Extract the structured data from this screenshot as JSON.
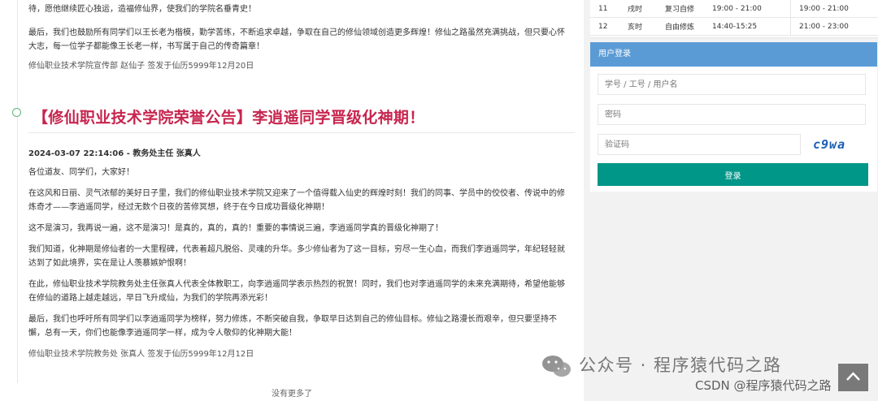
{
  "previous_post": {
    "paragraph_tail": "待，愿他继续匠心独运，造福修仙界，使我们的学院名垂青史！",
    "closing": "最后，我们也鼓励所有同学们以王长老为楷模，勤学苦练，不断追求卓越，争取在自己的修仙领域创造更多辉煌！修仙之路虽然充满挑战，但只要心怀大志，每一位学子都能像王长老一样，书写属于自己的传奇篇章！",
    "signature": "修仙职业技术学院宣传部 赵仙子 签发于仙历5999年12月20日"
  },
  "post": {
    "title": "【修仙职业技术学院荣誉公告】李逍遥同学晋级化神期！",
    "timestamp": "2024-03-07 22:14:06",
    "separator": "-",
    "author": "教务处主任 张真人",
    "paragraphs": [
      "各位道友、同学们，大家好！",
      "在这风和日丽、灵气浓郁的美好日子里，我们的修仙职业技术学院又迎来了一个值得载入仙史的辉煌时刻！我们的同事、学员中的佼佼者、传说中的修炼奇才——李逍遥同学，经过无数个日夜的苦修冥想，终于在今日成功晋级化神期！",
      "这不是演习，我再说一遍，这不是演习！是真的，真的，真的！重要的事情说三遍，李逍遥同学真的晋级化神期了！",
      "我们知道，化神期是修仙者的一大里程碑，代表着超凡脱俗、灵魂的升华。多少修仙者为了这一目标，穷尽一生心血，而我们李逍遥同学，年纪轻轻就达到了如此境界，实在是让人羡慕嫉妒恨啊！",
      "在此，修仙职业技术学院教务处主任张真人代表全体教职工，向李逍遥同学表示热烈的祝贺！同时，我们也对李逍遥同学的未来充满期待，希望他能够在修仙的道路上越走越远，早日飞升成仙，为我们的学院再添光彩！",
      "最后，我们也呼吁所有同学们以李逍遥同学为榜样，努力修炼，不断突破自我，争取早日达到自己的修仙目标。修仙之路漫长而艰辛，但只要坚持不懈，总有一天，你们也能像李逍遥同学一样，成为令人敬仰的化神期大能！"
    ],
    "signature": "修仙职业技术学院教务处 张真人 签发于仙历5999年12月12日"
  },
  "no_more_text": "没有更多了",
  "schedule": {
    "rows": [
      [
        "11",
        "戌时",
        "复习自修",
        "19:00 - 21:00",
        "19:00 - 21:00"
      ],
      [
        "12",
        "亥时",
        "自由修炼",
        "14:40-15:25",
        "21:00 - 23:00"
      ]
    ]
  },
  "login": {
    "header": "用户登录",
    "username_placeholder": "学号 / 工号 / 用户名",
    "password_placeholder": "密码",
    "captcha_placeholder": "验证码",
    "captcha_text": "c9wa",
    "submit_label": "登录"
  },
  "watermark": {
    "text": "公众号 · 程序猿代码之路",
    "csdn": "CSDN @程序猿代码之路"
  },
  "colors": {
    "title": "#c7254e",
    "login_header": "#5b9bd5",
    "login_button": "#009688",
    "timeline_dot": "#5fb878"
  },
  "icons": {
    "timeline_dot": "circle-outline",
    "back_to_top": "arrow-up-icon",
    "wechat": "wechat-icon"
  }
}
